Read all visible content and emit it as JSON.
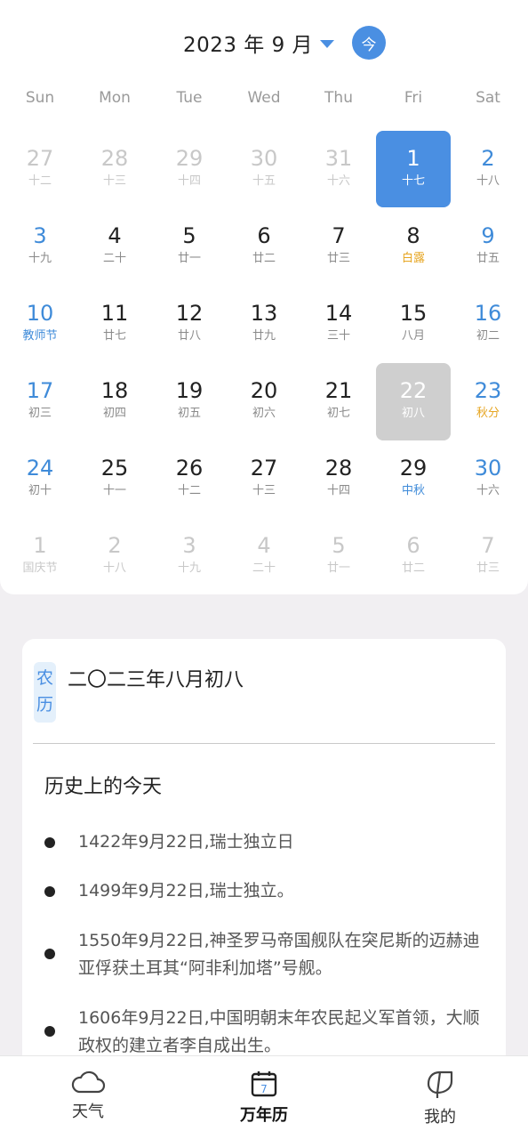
{
  "header": {
    "month_title": "2023 年 9 月",
    "today_button": "今"
  },
  "weekdays": [
    "Sun",
    "Mon",
    "Tue",
    "Wed",
    "Thu",
    "Fri",
    "Sat"
  ],
  "days": [
    {
      "num": "27",
      "sub": "十二",
      "state": "other"
    },
    {
      "num": "28",
      "sub": "十三",
      "state": "other"
    },
    {
      "num": "29",
      "sub": "十四",
      "state": "other"
    },
    {
      "num": "30",
      "sub": "十五",
      "state": "other"
    },
    {
      "num": "31",
      "sub": "十六",
      "state": "other"
    },
    {
      "num": "1",
      "sub": "十七",
      "state": "selected"
    },
    {
      "num": "2",
      "sub": "十八",
      "state": "normal"
    },
    {
      "num": "3",
      "sub": "十九",
      "state": "normal"
    },
    {
      "num": "4",
      "sub": "二十",
      "state": "normal"
    },
    {
      "num": "5",
      "sub": "廿一",
      "state": "normal"
    },
    {
      "num": "6",
      "sub": "廿二",
      "state": "normal"
    },
    {
      "num": "7",
      "sub": "廿三",
      "state": "normal"
    },
    {
      "num": "8",
      "sub": "白露",
      "state": "normal",
      "sub_type": "term"
    },
    {
      "num": "9",
      "sub": "廿五",
      "state": "normal"
    },
    {
      "num": "10",
      "sub": "教师节",
      "state": "normal",
      "sub_type": "festival"
    },
    {
      "num": "11",
      "sub": "廿七",
      "state": "normal"
    },
    {
      "num": "12",
      "sub": "廿八",
      "state": "normal"
    },
    {
      "num": "13",
      "sub": "廿九",
      "state": "normal"
    },
    {
      "num": "14",
      "sub": "三十",
      "state": "normal"
    },
    {
      "num": "15",
      "sub": "八月",
      "state": "normal"
    },
    {
      "num": "16",
      "sub": "初二",
      "state": "normal"
    },
    {
      "num": "17",
      "sub": "初三",
      "state": "normal"
    },
    {
      "num": "18",
      "sub": "初四",
      "state": "normal"
    },
    {
      "num": "19",
      "sub": "初五",
      "state": "normal"
    },
    {
      "num": "20",
      "sub": "初六",
      "state": "normal"
    },
    {
      "num": "21",
      "sub": "初七",
      "state": "normal"
    },
    {
      "num": "22",
      "sub": "初八",
      "state": "today"
    },
    {
      "num": "23",
      "sub": "秋分",
      "state": "normal",
      "sub_type": "term"
    },
    {
      "num": "24",
      "sub": "初十",
      "state": "normal"
    },
    {
      "num": "25",
      "sub": "十一",
      "state": "normal"
    },
    {
      "num": "26",
      "sub": "十二",
      "state": "normal"
    },
    {
      "num": "27",
      "sub": "十三",
      "state": "normal"
    },
    {
      "num": "28",
      "sub": "十四",
      "state": "normal"
    },
    {
      "num": "29",
      "sub": "中秋",
      "state": "normal",
      "sub_type": "festival"
    },
    {
      "num": "30",
      "sub": "十六",
      "state": "normal"
    },
    {
      "num": "1",
      "sub": "国庆节",
      "state": "other"
    },
    {
      "num": "2",
      "sub": "十八",
      "state": "other"
    },
    {
      "num": "3",
      "sub": "十九",
      "state": "other"
    },
    {
      "num": "4",
      "sub": "二十",
      "state": "other"
    },
    {
      "num": "5",
      "sub": "廿一",
      "state": "other"
    },
    {
      "num": "6",
      "sub": "廿二",
      "state": "other"
    },
    {
      "num": "7",
      "sub": "廿三",
      "state": "other"
    }
  ],
  "info": {
    "lunar_badge_1": "农",
    "lunar_badge_2": "历",
    "lunar_date": "二〇二三年八月初八",
    "history_title": "历史上的今天",
    "history": [
      "1422年9月22日,瑞士独立日",
      "1499年9月22日,瑞士独立。",
      "1550年9月22日,神圣罗马帝国舰队在突尼斯的迈赫迪亚俘获土耳其“阿非利加塔”号舰。",
      "1606年9月22日,中国明朝末年农民起义军首领，大顺政权的建立者李自成出生。"
    ]
  },
  "nav": {
    "weather": "天气",
    "calendar": "万年历",
    "calendar_icon_day": "7",
    "mine": "我的"
  },
  "colors": {
    "accent": "#4a8fe2",
    "weekend": "#3f8bd9",
    "solar_term": "#e6a521",
    "today_bg": "#cfcfcf",
    "page_bg": "#f1eff2"
  }
}
